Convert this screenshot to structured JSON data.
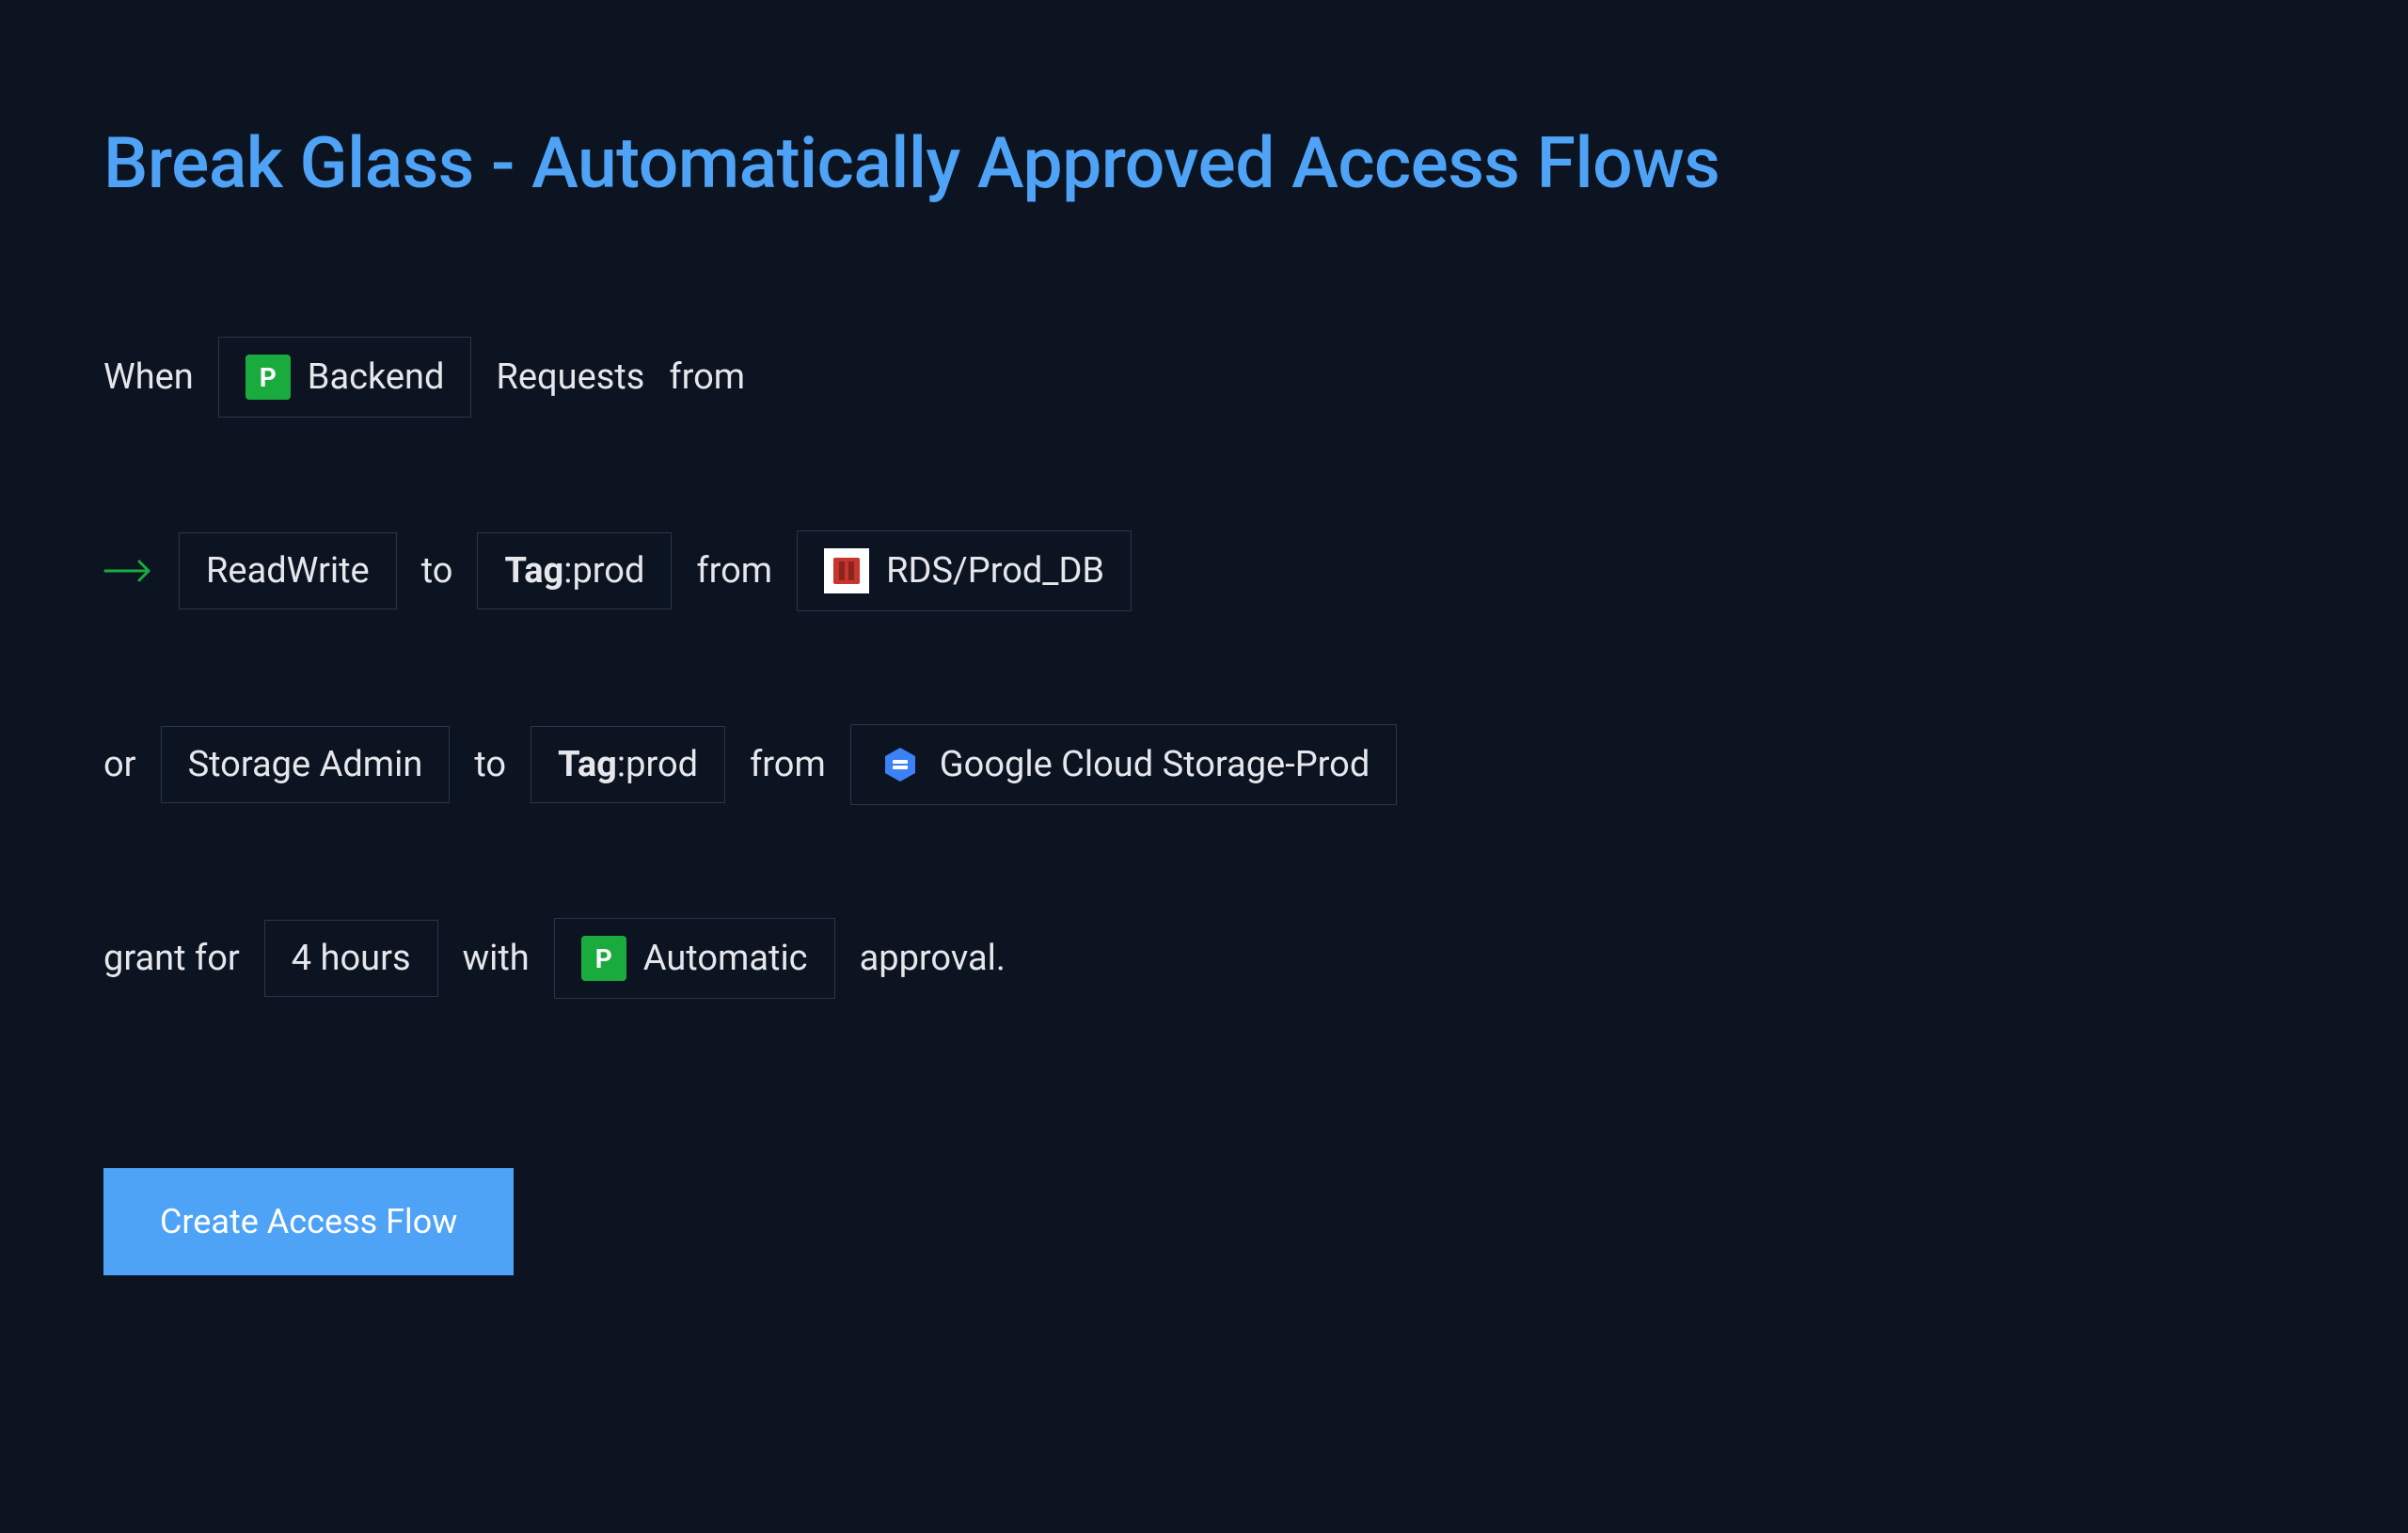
{
  "title": "Break Glass - Automatically Approved Access Flows",
  "row1": {
    "when": "When",
    "requester_icon": "P",
    "requester": "Backend",
    "requests": "Requests",
    "from": "from"
  },
  "row2": {
    "permission": "ReadWrite",
    "to": "to",
    "tag_label": "Tag",
    "tag_value": ":prod",
    "from": "from",
    "resource": "RDS/Prod_DB"
  },
  "row3": {
    "or": "or",
    "permission": "Storage Admin",
    "to": "to",
    "tag_label": "Tag",
    "tag_value": ":prod",
    "from": "from",
    "resource": "Google Cloud Storage-Prod"
  },
  "row4": {
    "grant_for": "grant for",
    "duration": "4 hours",
    "with": "with",
    "approval_icon": "P",
    "approval_type": "Automatic",
    "approval": "approval."
  },
  "button": {
    "create": "Create Access Flow"
  }
}
